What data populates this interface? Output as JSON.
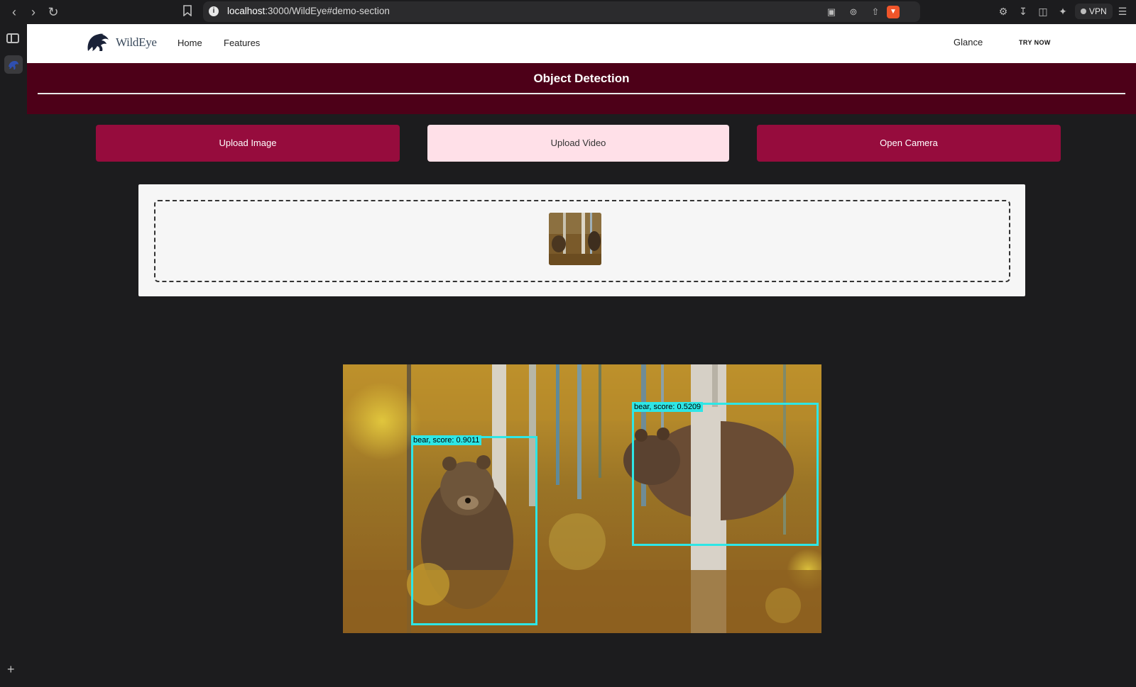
{
  "browser": {
    "url_host": "localhost",
    "url_path": ":3000/WildEye#demo-section",
    "vpn_label": "VPN",
    "icons": [
      "back-icon",
      "forward-icon",
      "reload-icon",
      "bookmark-icon",
      "info-icon",
      "cast-icon",
      "zoom-icon",
      "share-icon",
      "brave-shield-icon",
      "extensions-icon",
      "download-icon",
      "sidebar-toggle-icon",
      "leo-ai-icon",
      "vpn-icon",
      "menu-icon"
    ]
  },
  "site": {
    "brand": "WildEye",
    "nav": {
      "home": "Home",
      "features": "Features",
      "glance": "Glance",
      "try_now": "TRY NOW"
    },
    "section_title": "Object Detection",
    "buttons": {
      "upload_image": "Upload Image",
      "upload_video": "Upload Video",
      "open_camera": "Open Camera"
    }
  },
  "detections": [
    {
      "label": "bear, score: 0.9011"
    },
    {
      "label": "bear, score: 0.5209"
    }
  ],
  "colors": {
    "banner": "#4d0018",
    "button": "#960c3d",
    "button_active": "#ffe0e8",
    "bbox": "#2ee6e6"
  }
}
